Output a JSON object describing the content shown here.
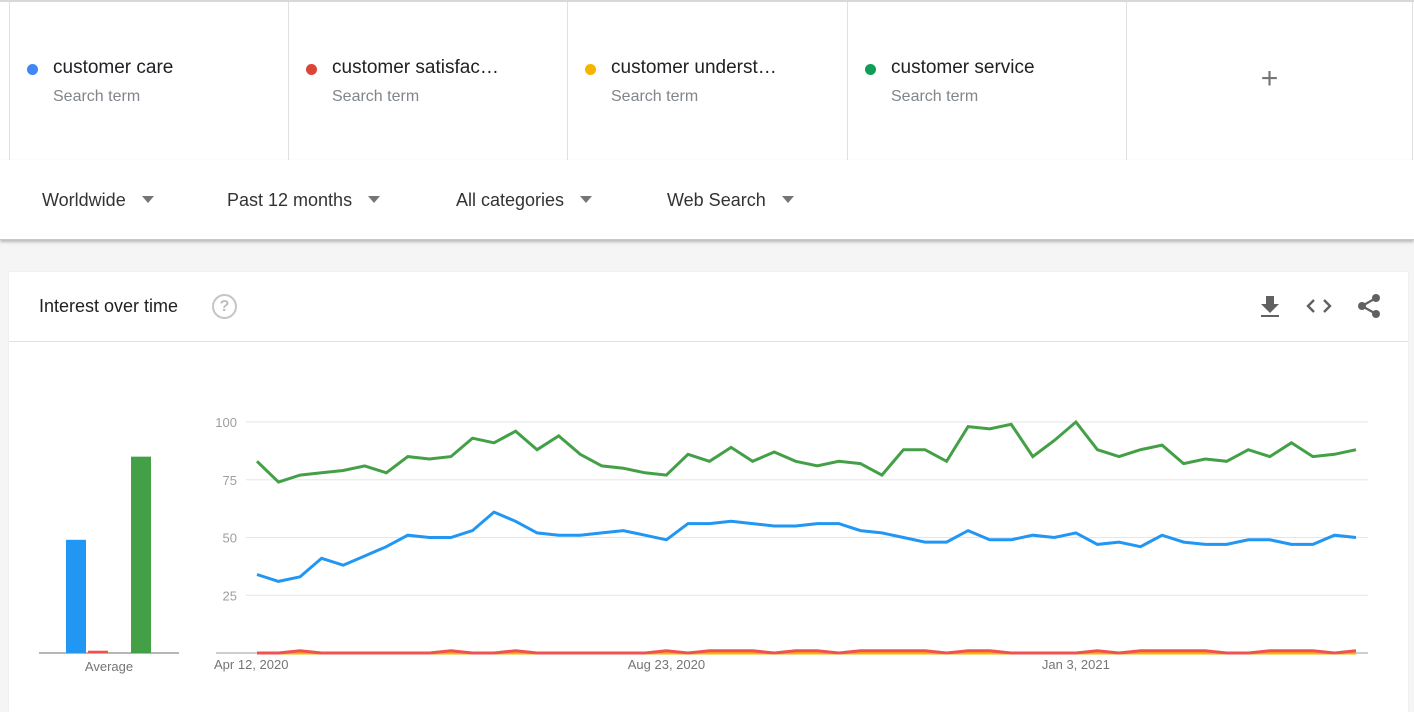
{
  "search_terms": [
    {
      "name": "customer care",
      "sub": "Search term",
      "color": "#4285f4"
    },
    {
      "name": "customer satisfac…",
      "sub": "Search term",
      "color": "#db4437"
    },
    {
      "name": "customer underst…",
      "sub": "Search term",
      "color": "#f4b400"
    },
    {
      "name": "customer service",
      "sub": "Search term",
      "color": "#0f9d58"
    }
  ],
  "add_term_label": "+",
  "filters": {
    "region": "Worldwide",
    "time": "Past 12 months",
    "category": "All categories",
    "property": "Web Search"
  },
  "card": {
    "title": "Interest over time",
    "help_label": "?",
    "icons": [
      "download-icon",
      "embed-icon",
      "share-icon"
    ]
  },
  "chart_data": [
    {
      "type": "bar",
      "title": "",
      "categories": [
        "Average"
      ],
      "series": [
        {
          "name": "customer care",
          "color": "#2196f3",
          "values": [
            49
          ]
        },
        {
          "name": "customer satisfaction",
          "color": "#ef5350",
          "values": [
            1
          ]
        },
        {
          "name": "customer understanding",
          "color": "#ffb300",
          "values": [
            0
          ]
        },
        {
          "name": "customer service",
          "color": "#43a047",
          "values": [
            85
          ]
        }
      ],
      "xlabel": "Average",
      "ylim": [
        0,
        100
      ]
    },
    {
      "type": "line",
      "title": "",
      "xlabel": "",
      "ylabel": "",
      "ylim": [
        0,
        100
      ],
      "yticks": [
        25,
        50,
        75,
        100
      ],
      "x_tick_labels": [
        {
          "index": 0,
          "label": "Apr 12, 2020"
        },
        {
          "index": 19,
          "label": "Aug 23, 2020"
        },
        {
          "index": 38,
          "label": "Jan 3, 2021"
        }
      ],
      "grid": true,
      "num_points": 52,
      "series": [
        {
          "name": "customer care",
          "color": "#2196f3",
          "values": [
            34,
            31,
            33,
            41,
            38,
            42,
            46,
            51,
            50,
            50,
            53,
            61,
            57,
            52,
            51,
            51,
            52,
            53,
            51,
            49,
            56,
            56,
            57,
            56,
            55,
            55,
            56,
            56,
            53,
            52,
            50,
            48,
            48,
            53,
            49,
            49,
            51,
            50,
            52,
            47,
            48,
            46,
            51,
            48,
            47,
            47,
            49,
            49,
            47,
            47,
            51,
            50
          ]
        },
        {
          "name": "customer satisfaction",
          "color": "#ef5350",
          "values": [
            0,
            0,
            1,
            0,
            0,
            0,
            0,
            0,
            0,
            1,
            0,
            0,
            1,
            0,
            0,
            0,
            0,
            0,
            0,
            1,
            0,
            1,
            1,
            1,
            0,
            1,
            1,
            0,
            1,
            1,
            1,
            1,
            0,
            1,
            1,
            0,
            0,
            0,
            0,
            1,
            0,
            1,
            1,
            1,
            1,
            0,
            0,
            1,
            1,
            1,
            0,
            1
          ]
        },
        {
          "name": "customer understanding",
          "color": "#ffb300",
          "values": [
            0,
            0,
            0,
            0,
            0,
            0,
            0,
            0,
            0,
            0,
            0,
            0,
            0,
            0,
            0,
            0,
            0,
            0,
            0,
            0,
            0,
            0,
            0,
            0,
            0,
            0,
            0,
            0,
            0,
            0,
            0,
            0,
            0,
            0,
            0,
            0,
            0,
            0,
            0,
            0,
            0,
            0,
            0,
            0,
            0,
            0,
            0,
            0,
            0,
            0,
            0,
            0
          ]
        },
        {
          "name": "customer service",
          "color": "#43a047",
          "values": [
            83,
            74,
            77,
            78,
            79,
            81,
            78,
            85,
            84,
            85,
            93,
            91,
            96,
            88,
            94,
            86,
            81,
            80,
            78,
            77,
            86,
            83,
            89,
            83,
            87,
            83,
            81,
            83,
            82,
            77,
            88,
            88,
            83,
            98,
            97,
            99,
            85,
            92,
            100,
            88,
            85,
            88,
            90,
            82,
            84,
            83,
            88,
            85,
            91,
            85,
            86,
            88
          ]
        }
      ]
    }
  ]
}
